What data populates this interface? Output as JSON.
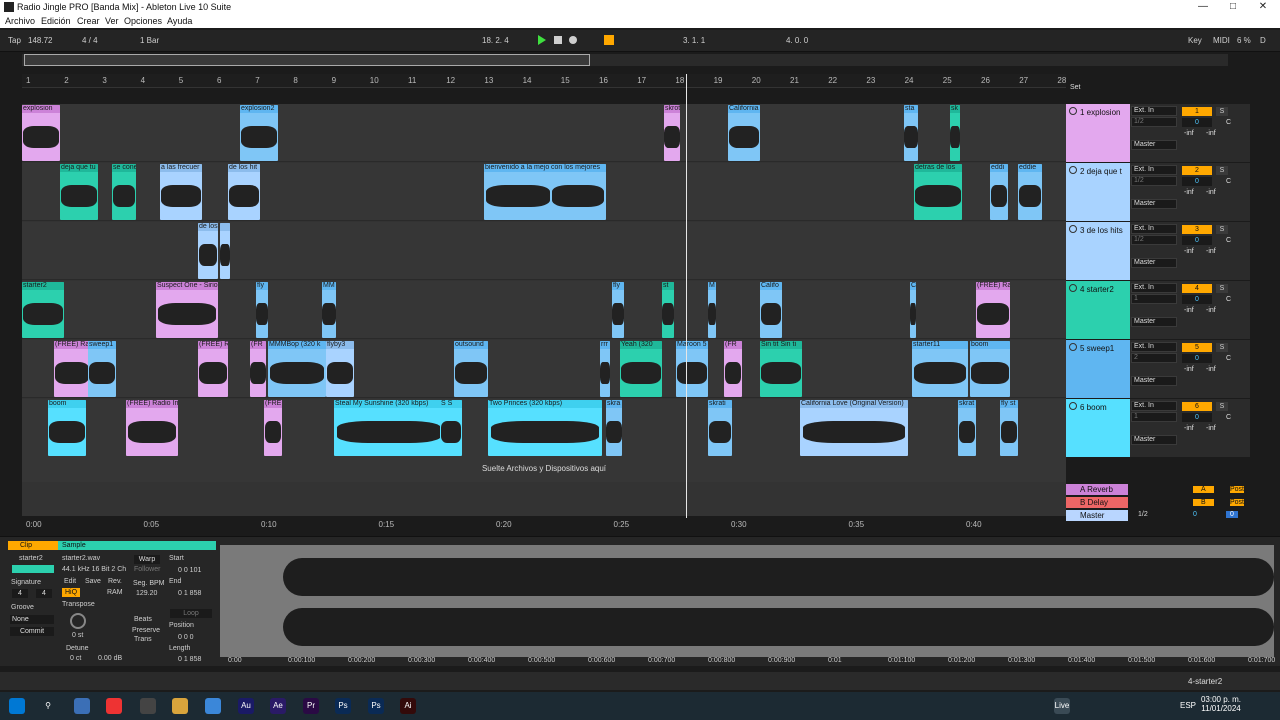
{
  "window": {
    "title": "Radio Jingle PRO  [Banda Mix] - Ableton Live 10 Suite"
  },
  "menu": [
    "Archivo",
    "Edición",
    "Crear",
    "Ver",
    "Opciones",
    "Ayuda"
  ],
  "transport": {
    "tap": "Tap",
    "tempo": "148.72",
    "signature": "4 / 4",
    "quantize": "1 Bar",
    "position": "18.  2.  4",
    "loop_start": "3.  1.  1",
    "loop_length": "4.  0.  0",
    "key": "Key",
    "midi": "MIDI",
    "cpu": "6 %",
    "d": "D"
  },
  "ruler": [
    "1",
    "2",
    "3",
    "4",
    "5",
    "6",
    "7",
    "8",
    "9",
    "10",
    "11",
    "12",
    "13",
    "14",
    "15",
    "16",
    "17",
    "18",
    "19",
    "20",
    "21",
    "22",
    "23",
    "24",
    "25",
    "26",
    "27",
    "28"
  ],
  "timebar": [
    "0:00",
    "0:05",
    "0:10",
    "0:15",
    "0:20",
    "0:25",
    "0:30",
    "0:35",
    "0:40"
  ],
  "drop_text": "Suelte Archivos y Dispositivos aquí",
  "set_label": "Set",
  "tracks": [
    {
      "name": "1 explosion",
      "num": "1",
      "color": "#e3a8ee",
      "input": "Ext. In",
      "chan": "1/2",
      "out": "Master",
      "vol": "0",
      "pan": "C"
    },
    {
      "name": "2 deja que t",
      "num": "2",
      "color": "#a9d3ff",
      "input": "Ext. In",
      "chan": "1/2",
      "out": "Master",
      "vol": "0",
      "pan": "C"
    },
    {
      "name": "3 de los hits",
      "num": "3",
      "color": "#a9d3ff",
      "input": "Ext. In",
      "chan": "1/2",
      "out": "Master",
      "vol": "0",
      "pan": "C"
    },
    {
      "name": "4 starter2",
      "num": "4",
      "color": "#2cd0ae",
      "input": "Ext. In",
      "chan": "1",
      "out": "Master",
      "vol": "0",
      "pan": "C"
    },
    {
      "name": "5 sweep1",
      "num": "5",
      "color": "#5fb6f1",
      "input": "Ext. In",
      "chan": "2",
      "out": "Master",
      "vol": "0",
      "pan": "C"
    },
    {
      "name": "6 boom",
      "num": "6",
      "color": "#56e0ff",
      "input": "Ext. In",
      "chan": "1",
      "out": "Master",
      "vol": "0",
      "pan": "C"
    }
  ],
  "returns": [
    {
      "name": "A Reverb",
      "letter": "A",
      "post": "Post"
    },
    {
      "name": "B Delay",
      "letter": "B",
      "post": "Post"
    },
    {
      "name": "Master",
      "chan": "1/2",
      "vol": "0",
      "vol2": "0"
    }
  ],
  "inf": "-inf",
  "clips": {
    "t1": [
      [
        "explosion",
        0,
        38,
        "pink"
      ],
      [
        "explosion2",
        218,
        38,
        "blue"
      ],
      [
        "skrot",
        642,
        16,
        "pink"
      ],
      [
        "California",
        706,
        32,
        "blue"
      ],
      [
        "sta",
        882,
        14,
        "blue"
      ],
      [
        "sk",
        928,
        10,
        "teal"
      ]
    ],
    "t2": [
      [
        "deja que tu",
        38,
        38,
        "teal"
      ],
      [
        "se cone",
        90,
        24,
        "teal"
      ],
      [
        "a las frecuer",
        138,
        42,
        "lblue"
      ],
      [
        "de los hit",
        206,
        32,
        "lblue"
      ],
      [
        "bienvenido a la mejo",
        462,
        68,
        "blue"
      ],
      [
        "con los mejores",
        528,
        56,
        "blue"
      ],
      [
        "detras de los",
        892,
        48,
        "teal"
      ],
      [
        "eddi",
        968,
        18,
        "blue"
      ],
      [
        "eddie",
        996,
        24,
        "blue"
      ]
    ],
    "t3": [
      [
        "de los",
        176,
        20,
        "lblue"
      ],
      [
        "",
        198,
        10,
        "lblue"
      ]
    ],
    "t4": [
      [
        "starter2",
        0,
        42,
        "teal"
      ],
      [
        "Suspect One - Sirio",
        134,
        62,
        "pink"
      ],
      [
        "fly",
        234,
        12,
        "blue"
      ],
      [
        "MM",
        300,
        14,
        "blue"
      ],
      [
        "fly",
        590,
        12,
        "blue"
      ],
      [
        "st",
        640,
        12,
        "teal"
      ],
      [
        "M",
        686,
        8,
        "blue"
      ],
      [
        "Califo",
        738,
        22,
        "blue"
      ],
      [
        "C",
        888,
        6,
        "blue"
      ],
      [
        "(FREE) Ra",
        954,
        34,
        "pink"
      ]
    ],
    "t5": [
      [
        "(FREE) Ra",
        32,
        36,
        "pink"
      ],
      [
        "sweep1",
        66,
        28,
        "blue"
      ],
      [
        "(FREE) R",
        176,
        30,
        "pink"
      ],
      [
        "(FR",
        228,
        16,
        "pink"
      ],
      [
        "MMMBop (320 k",
        246,
        58,
        "blue"
      ],
      [
        "flyby3",
        304,
        28,
        "lblue"
      ],
      [
        "outsound",
        432,
        34,
        "blue"
      ],
      [
        "rrr",
        578,
        10,
        "blue"
      ],
      [
        "Yeah (320",
        598,
        42,
        "teal"
      ],
      [
        "Maroon 5",
        654,
        32,
        "blue"
      ],
      [
        "(FR",
        702,
        18,
        "pink"
      ],
      [
        "Sin tit Sin ti",
        738,
        42,
        "teal"
      ],
      [
        "starter11",
        890,
        56,
        "blue"
      ],
      [
        "boom",
        948,
        40,
        "blue"
      ]
    ],
    "t6": [
      [
        "boom",
        26,
        38,
        "cyan"
      ],
      [
        "(FREE) Radio Im",
        104,
        52,
        "pink"
      ],
      [
        "(FRE",
        242,
        18,
        "pink"
      ],
      [
        "Steal My Sunshine (320 kbps)",
        312,
        110,
        "cyan"
      ],
      [
        "S S",
        418,
        22,
        "cyan"
      ],
      [
        "Two Princes (320 kbps)",
        466,
        114,
        "cyan"
      ],
      [
        "skra",
        584,
        16,
        "blue"
      ],
      [
        "skrati",
        686,
        24,
        "blue"
      ],
      [
        "California Love (Original Version)",
        778,
        108,
        "lblue"
      ],
      [
        "skrat",
        936,
        18,
        "blue"
      ],
      [
        "fly st",
        978,
        18,
        "blue"
      ]
    ]
  },
  "detail": {
    "clip_tab": "Clip",
    "sample_tab": "Sample",
    "clip_name": "starter2",
    "signature_label": "Signature",
    "sig_num": "4",
    "sig_den": "4",
    "groove_label": "Groove",
    "groove_val": "None",
    "commit": "Commit",
    "file": "starter2.wav",
    "format": "44.1 kHz 16 Bit 2 Ch",
    "edit": "Edit",
    "save": "Save",
    "rev": "Rev.",
    "hiq": "HiQ",
    "ram": "RAM",
    "transpose": "Transpose",
    "transpose_val": "0 st",
    "detune": "Detune",
    "detune_val": "0 ct",
    "gain": "0.00 dB",
    "warp": "Warp",
    "follower": "Follower",
    "seg_bpm": "Seg. BPM",
    "bpm_val": "129.20",
    "beats": "Beats",
    "preserve": "Preserve",
    "trans": "Trans",
    "start": "Start",
    "start_val": "0  0  101",
    "end": "End",
    "end_val": "0  1  858",
    "loop": "Loop",
    "position": "Position",
    "pos_val": "0  0  0",
    "length": "Length",
    "len_val": "0  1  858",
    "times": [
      "0:00",
      "0:00:100",
      "0:00:200",
      "0:00:300",
      "0:00:400",
      "0:00:500",
      "0:00:600",
      "0:00:700",
      "0:00:800",
      "0:00:900",
      "0:01",
      "0:01:100",
      "0:01:200",
      "0:01:300",
      "0:01:400",
      "0:01:500",
      "0:01:600",
      "0:01:700"
    ]
  },
  "status": {
    "track": "4-starter2"
  },
  "taskbar": {
    "lang": "ESP",
    "time": "03:00 p. m.",
    "date": "11/01/2024",
    "live": "Live"
  }
}
